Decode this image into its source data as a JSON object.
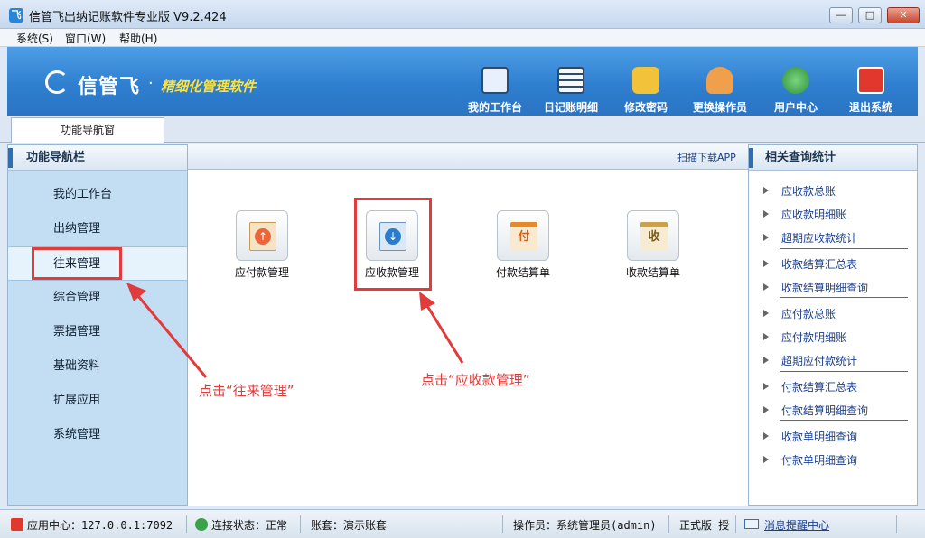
{
  "window": {
    "title": "信管飞出纳记账软件专业版 V9.2.424",
    "min": "—",
    "max": "□",
    "close": "✕"
  },
  "menu": [
    "系统(S)",
    "窗口(W)",
    "帮助(H)"
  ],
  "banner": {
    "logo": "信管飞",
    "dot": "·",
    "slogan": "精细化管理软件"
  },
  "toolbar": [
    {
      "label": "我的工作台",
      "icon": "monitor-icon",
      "color": "#e8f1fb"
    },
    {
      "label": "日记账明细",
      "icon": "ledger-icon",
      "color": "#f4f7fb"
    },
    {
      "label": "修改密码",
      "icon": "lock-icon",
      "color": "#f2c23a"
    },
    {
      "label": "更换操作员",
      "icon": "user-icon",
      "color": "#f0a04b"
    },
    {
      "label": "用户中心",
      "icon": "globe-icon",
      "color": "#48b34f"
    },
    {
      "label": "退出系统",
      "icon": "power-icon",
      "color": "#e0382d"
    }
  ],
  "tab": "功能导航窗",
  "nav": {
    "title": "功能导航栏",
    "items": [
      "我的工作台",
      "出纳管理",
      "往来管理",
      "综合管理",
      "票据管理",
      "基础资料",
      "扩展应用",
      "系统管理"
    ],
    "active_index": 2
  },
  "main": {
    "qr_link": "扫描下载APP",
    "functions": [
      {
        "label": "应付款管理",
        "icon": "payable-icon",
        "glyph_char": "↑",
        "color": "#e9663b"
      },
      {
        "label": "应收款管理",
        "icon": "receivable-icon",
        "glyph_char": "↓",
        "color": "#2d7cc9"
      },
      {
        "label": "付款结算单",
        "icon": "payment-voucher-icon",
        "glyph_char": "付",
        "color": "#e58a2a"
      },
      {
        "label": "收款结算单",
        "icon": "receipt-voucher-icon",
        "glyph_char": "收",
        "color": "#c9a24a"
      }
    ]
  },
  "annotations": {
    "left": "点击“往来管理”",
    "right": "点击“应收款管理”",
    "color": "#e23b3b"
  },
  "right_panel": {
    "title": "相关查询统计",
    "items": [
      "应收款总账",
      "应收款明细账",
      "超期应收款统计",
      "收款结算汇总表",
      "收款结算明细查询",
      "应付款总账",
      "应付款明细账",
      "超期应付款统计",
      "付款结算汇总表",
      "付款结算明细查询",
      "收款单明细查询",
      "付款单明细查询"
    ]
  },
  "status": {
    "app_center": "应用中心：127.0.0.1:7092",
    "connection": "连接状态：正常",
    "account": "账套：演示账套",
    "operator": "操作员：系统管理员(admin)",
    "edition": "正式版 授",
    "notice": "消息提醒中心"
  }
}
